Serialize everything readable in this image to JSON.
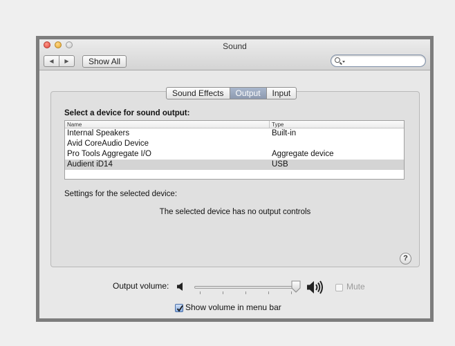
{
  "window": {
    "title": "Sound",
    "nav": {
      "back_icon": "◀",
      "forward_icon": "▶"
    },
    "show_all_label": "Show All",
    "search": {
      "placeholder": ""
    }
  },
  "tabs": [
    {
      "label": "Sound Effects",
      "active": false
    },
    {
      "label": "Output",
      "active": true
    },
    {
      "label": "Input",
      "active": false
    }
  ],
  "output": {
    "select_label": "Select a device for sound output:",
    "columns": {
      "name": "Name",
      "type": "Type"
    },
    "devices": [
      {
        "name": "Internal Speakers",
        "type": "Built-in",
        "selected": false
      },
      {
        "name": "Avid CoreAudio Device",
        "type": "",
        "selected": false
      },
      {
        "name": "Pro Tools Aggregate I/O",
        "type": "Aggregate device",
        "selected": false
      },
      {
        "name": "Audient iD14",
        "type": "USB",
        "selected": true
      }
    ],
    "settings_label": "Settings for the selected device:",
    "no_controls_text": "The selected device has no output controls",
    "help_label": "?"
  },
  "volume": {
    "label": "Output volume:",
    "level": 1.0,
    "mute_label": "Mute",
    "mute_checked": false,
    "mute_enabled": false,
    "menu_bar_label": "Show volume in menu bar",
    "menu_bar_checked": true
  }
}
